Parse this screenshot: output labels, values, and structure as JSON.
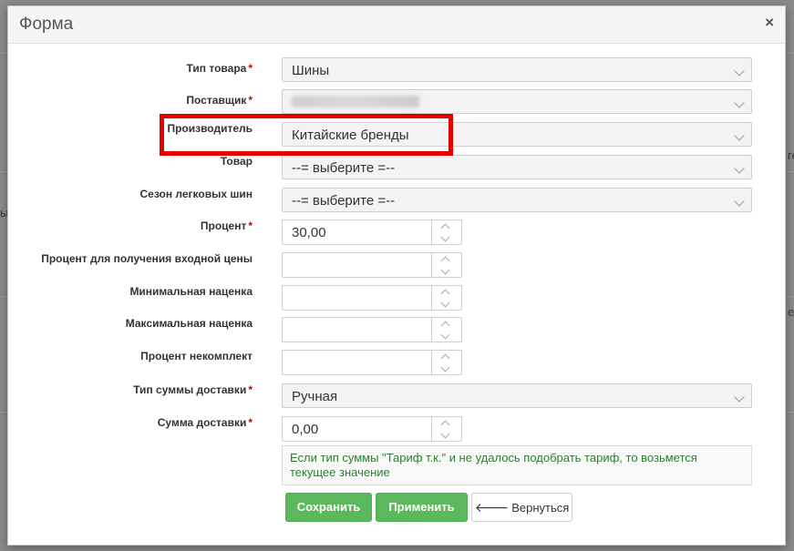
{
  "modal": {
    "title": "Форма",
    "close": "×"
  },
  "background": {
    "fragments": [
      "ге",
      "ы",
      "е"
    ]
  },
  "fields": {
    "product_type": {
      "label": "Тип товара",
      "required": "*",
      "value": "Шины"
    },
    "supplier": {
      "label": "Поставщик",
      "required": "*",
      "value": ""
    },
    "manufacturer": {
      "label": "Производитель",
      "value": "Китайские бренды"
    },
    "product": {
      "label": "Товар",
      "value": "--= выберите =--"
    },
    "season": {
      "label": "Сезон легковых шин",
      "value": "--= выберите =--"
    },
    "percent": {
      "label": "Процент",
      "required": "*",
      "value": "30,00"
    },
    "percent_input_price": {
      "label": "Процент для получения входной цены",
      "value": ""
    },
    "min_markup": {
      "label": "Минимальная наценка",
      "value": ""
    },
    "max_markup": {
      "label": "Максимальная наценка",
      "value": ""
    },
    "percent_incomplete": {
      "label": "Процент некомплект",
      "value": ""
    },
    "delivery_type": {
      "label": "Тип суммы доставки",
      "required": "*",
      "value": "Ручная"
    },
    "delivery_sum": {
      "label": "Сумма доставки",
      "required": "*",
      "value": "0,00"
    }
  },
  "hint": "Если тип суммы \"Тариф т.к.\" и не удалось подобрать тариф, то возьмется текущее значение",
  "buttons": {
    "save": "Сохранить",
    "apply": "Применить",
    "back": "Вернуться"
  },
  "colors": {
    "accent_green": "#5cb85c",
    "highlight_red": "#e30000",
    "required_red": "#cc0000",
    "hint_text": "#2e7d32"
  }
}
